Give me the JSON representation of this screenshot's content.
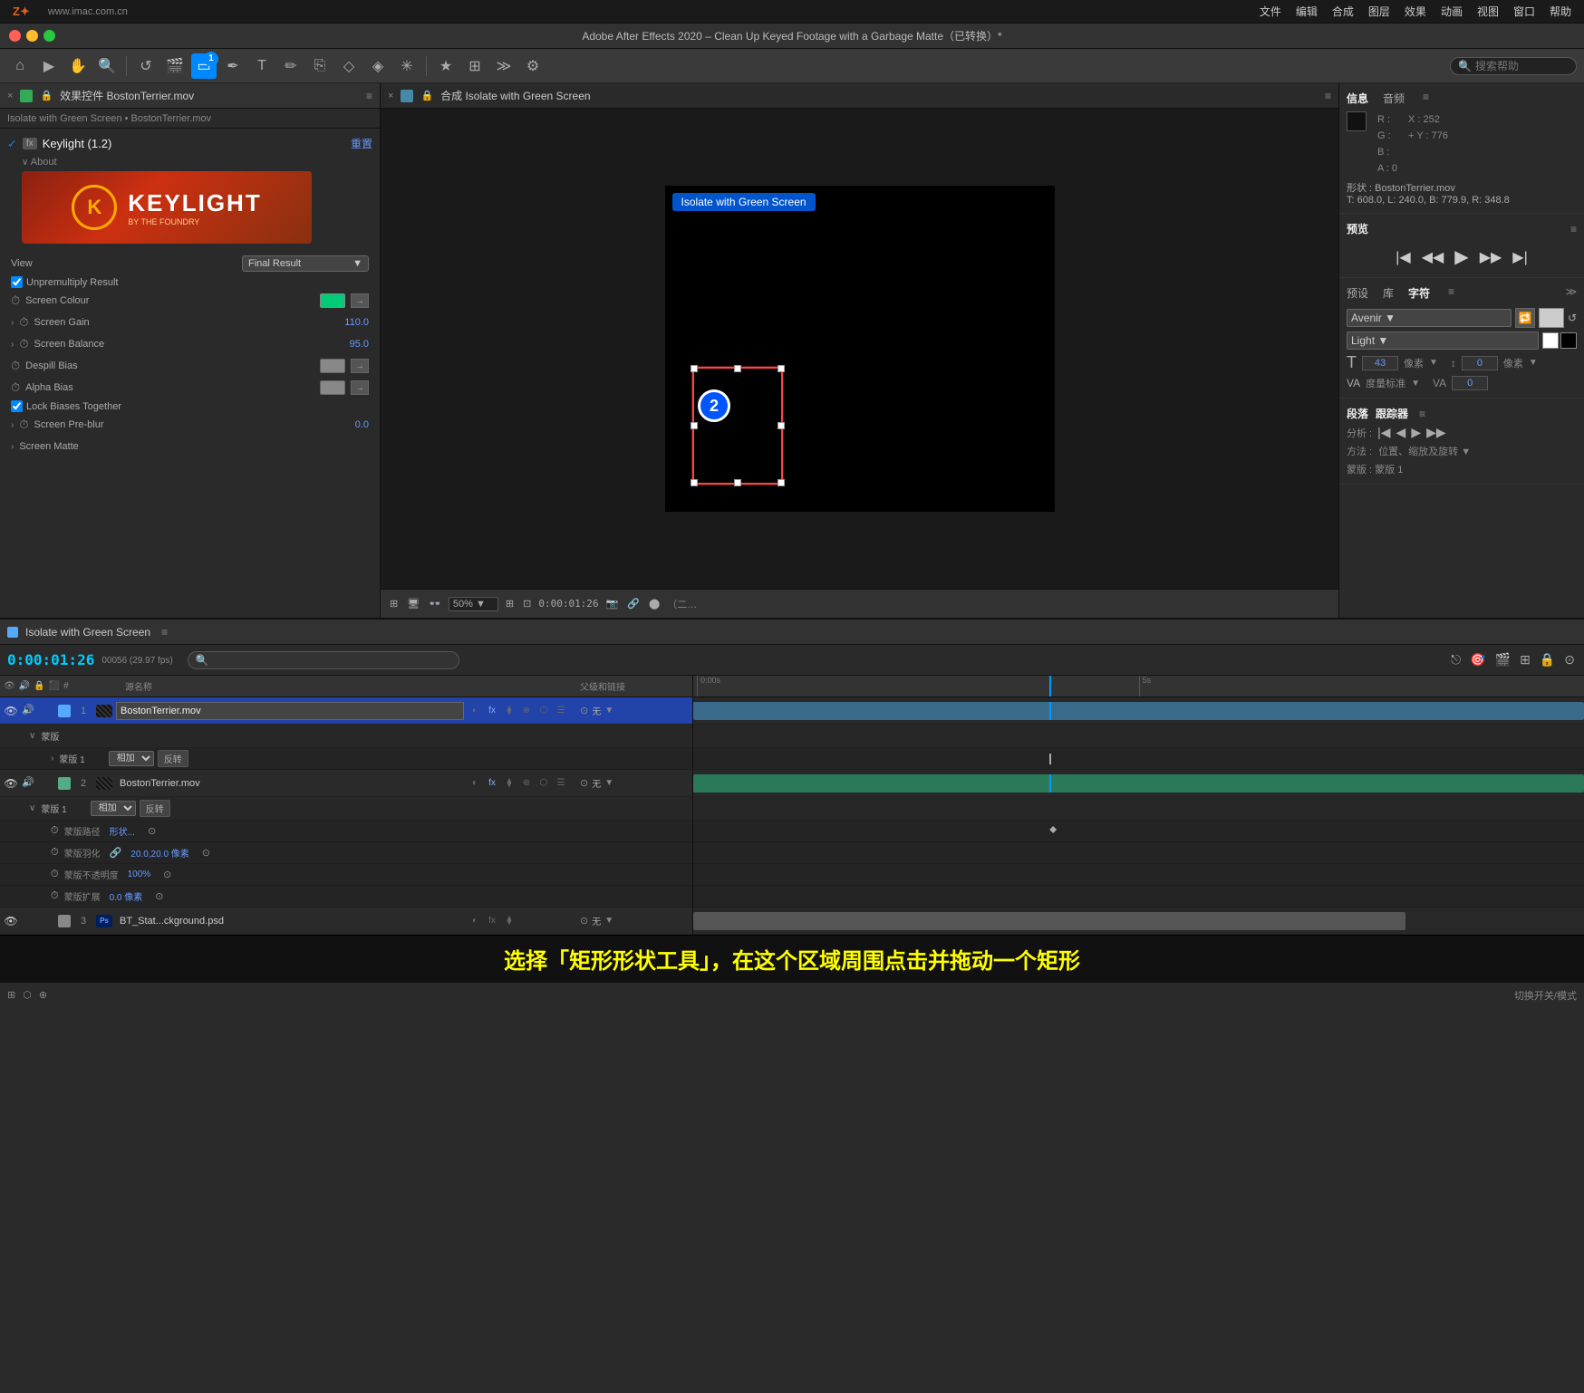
{
  "app": {
    "name": "After Effects",
    "version": "Adobe After Effects 2020",
    "title": "Adobe After Effects 2020 – Clean Up Keyed Footage with a Garbage Matte（已转换）*",
    "watermark": "www.imac.com.cn"
  },
  "menu": {
    "items": [
      "文件",
      "编辑",
      "合成",
      "图层",
      "效果",
      "动画",
      "视图",
      "窗口",
      "帮助"
    ]
  },
  "toolbar": {
    "search_placeholder": "搜索帮助"
  },
  "left_panel": {
    "tab_title": "效果控件 BostonTerrier.mov",
    "breadcrumb": "Isolate with Green Screen • BostonTerrier.mov",
    "effect_name": "Keylight (1.2)",
    "fx_label": "fx",
    "reset_label": "重置",
    "about_label": "About",
    "logo_text": "KEYLIGHT",
    "logo_sub": "BY THE FOUNDRY",
    "view_label": "View",
    "view_value": "Final Result",
    "unpremultiply_label": "Unpremultiply Result",
    "screen_colour_label": "Screen Colour",
    "screen_gain_label": "Screen Gain",
    "screen_gain_value": "110.0",
    "screen_balance_label": "Screen Balance",
    "screen_balance_value": "95.0",
    "despill_bias_label": "Despill Bias",
    "alpha_bias_label": "Alpha Bias",
    "lock_biases_label": "Lock Biases Together",
    "screen_pre_blur_label": "Screen Pre-blur",
    "screen_pre_blur_value": "0.0",
    "screen_matte_label": "Screen Matte"
  },
  "comp_panel": {
    "tab_title": "合成 Isolate with Green Screen",
    "comp_label": "Isolate with Green Screen",
    "zoom_value": "50%",
    "time_display": "0:00:01:26",
    "step1_label": "1",
    "step2_label": "2"
  },
  "info_panel": {
    "tab1": "信息",
    "tab2": "音频",
    "r_label": "R :",
    "g_label": "G :",
    "b_label": "B :",
    "a_label": "A :",
    "a_val": "0",
    "x_label": "X :",
    "x_val": "252",
    "y_label": "+ Y :",
    "y_val": "776",
    "shape_label": "形状 : BostonTerrier.mov",
    "shape_coords": "T: 608.0,  L: 240.0,  B: 779.9,  R: 348.8"
  },
  "preview_panel": {
    "title": "预览",
    "eq_icon": "≡"
  },
  "char_panel": {
    "tab1": "预设",
    "tab2": "库",
    "tab3": "字符",
    "eq_icon": "≡",
    "font_name": "Avenir",
    "font_style": "Light",
    "size_label": "像素",
    "size_val": "43",
    "size_unit": "像素",
    "offset_val": "0",
    "offset_label": "像素",
    "tracking_label": "度量标准",
    "va_val": "0"
  },
  "tracker_panel": {
    "tab1": "段落",
    "tab2": "跟踪器",
    "eq_icon": "≡",
    "analyze_label": "分析 :",
    "method_label": "方法 :",
    "method_val": "位置、缩放及旋转",
    "mask_label": "蒙版 : 蒙版 1"
  },
  "timeline": {
    "comp_name": "Isolate with Green Screen",
    "eq_icon": "≡",
    "current_time": "0:00:01:26",
    "fps_info": "00056 (29.97 fps)",
    "layer_headers": [
      "源名称",
      "父级和链接"
    ],
    "col_icons": [
      "#"
    ],
    "layers": [
      {
        "num": "1",
        "name": "BostonTerrier.mov",
        "color": "#55aaff",
        "has_mask": true,
        "mask_name": "蒙版",
        "mask1_name": "蒙版 1",
        "mask1_blend": "相加",
        "mask1_invert": "反转",
        "parent": "无"
      },
      {
        "num": "2",
        "name": "BostonTerrier.mov",
        "color": "#55aa88",
        "has_mask": true,
        "mask_name": "蒙版 1",
        "mask1_blend": "相加",
        "mask1_invert": "反转",
        "mask_path_label": "蒙版路径",
        "mask_path_val": "形状...",
        "mask_feather_label": "蒙版羽化",
        "mask_feather_val": "20.0,20.0 像素",
        "mask_opacity_label": "蒙版不透明度",
        "mask_opacity_val": "100%",
        "mask_expand_label": "蒙版扩展",
        "mask_expand_val": "0.0 像素",
        "parent": "无"
      },
      {
        "num": "3",
        "name": "BT_Stat...ckground.psd",
        "color": "#888888",
        "type": "ps",
        "parent": "无"
      }
    ]
  },
  "status": {
    "instruction": "选择「矩形形状工具」，在这个区域周围点击并拖动一个矩形",
    "bottom_label": "切换开关/模式"
  }
}
